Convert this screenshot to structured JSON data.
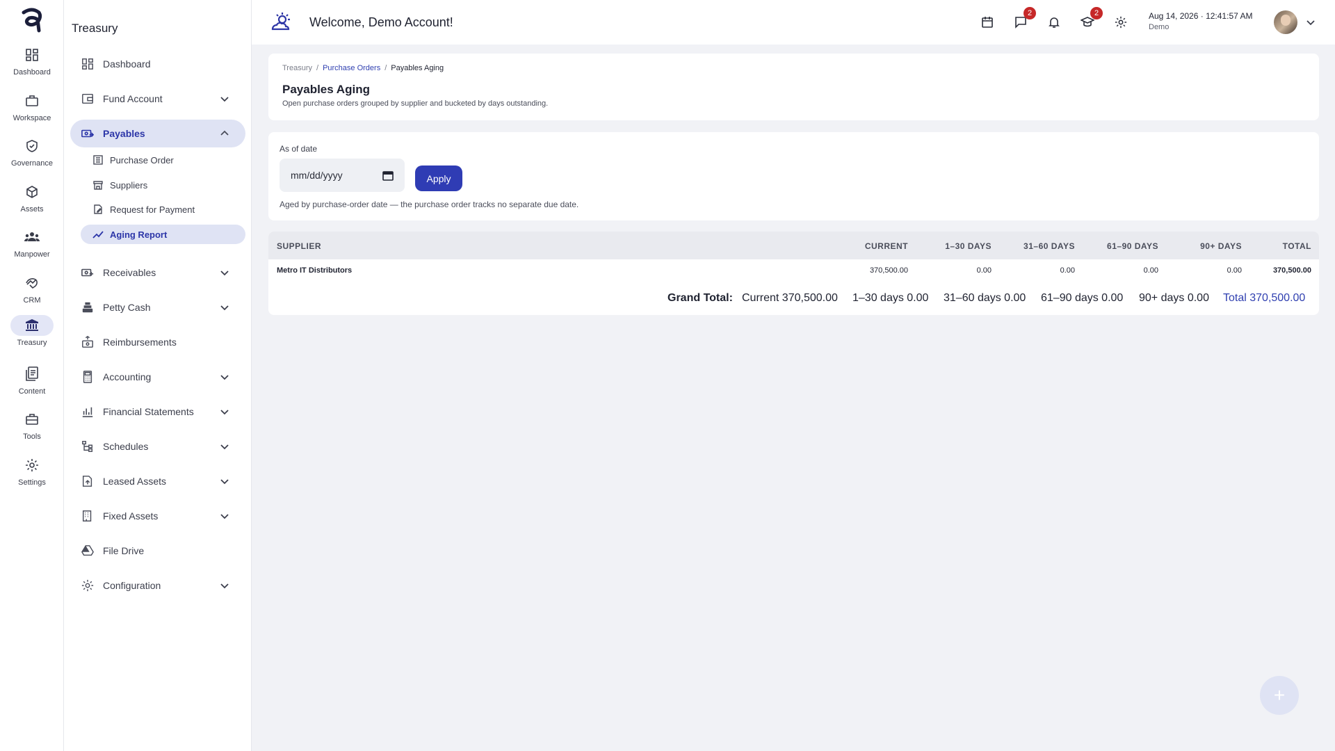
{
  "rail": {
    "items": [
      {
        "label": "Dashboard",
        "icon": "dashboard-icon"
      },
      {
        "label": "Workspace",
        "icon": "briefcase-icon"
      },
      {
        "label": "Governance",
        "icon": "shield-check-icon"
      },
      {
        "label": "Assets",
        "icon": "cube-icon"
      },
      {
        "label": "Manpower",
        "icon": "people-icon"
      },
      {
        "label": "CRM",
        "icon": "handshake-icon"
      },
      {
        "label": "Treasury",
        "icon": "bank-icon"
      },
      {
        "label": "Content",
        "icon": "documents-icon"
      },
      {
        "label": "Tools",
        "icon": "toolbox-icon"
      },
      {
        "label": "Settings",
        "icon": "gear-icon"
      }
    ]
  },
  "sidebar": {
    "title": "Treasury",
    "items": [
      {
        "label": "Dashboard",
        "icon": "dashboard-icon"
      },
      {
        "label": "Fund Account",
        "icon": "wallet-icon"
      },
      {
        "label": "Payables",
        "icon": "money-out-icon"
      },
      {
        "label": "Receivables",
        "icon": "money-in-icon"
      },
      {
        "label": "Petty Cash",
        "icon": "cash-register-icon"
      },
      {
        "label": "Reimbursements",
        "icon": "cash-hand-icon"
      },
      {
        "label": "Accounting",
        "icon": "calculator-icon"
      },
      {
        "label": "Financial Statements",
        "icon": "chart-icon"
      },
      {
        "label": "Schedules",
        "icon": "tree-icon"
      },
      {
        "label": "Leased Assets",
        "icon": "lease-icon"
      },
      {
        "label": "Fixed Assets",
        "icon": "building-icon"
      },
      {
        "label": "File Drive",
        "icon": "drive-icon"
      },
      {
        "label": "Configuration",
        "icon": "gear-icon"
      }
    ],
    "payables_sub": [
      {
        "label": "Purchase Order",
        "icon": "list-icon"
      },
      {
        "label": "Suppliers",
        "icon": "store-icon"
      },
      {
        "label": "Request for Payment",
        "icon": "doc-edit-icon"
      },
      {
        "label": "Aging Report",
        "icon": "trend-icon"
      }
    ]
  },
  "topbar": {
    "welcome": "Welcome, Demo Account!",
    "messages_badge": "2",
    "training_badge": "2",
    "date": "Aug 14, 2026 ·",
    "time": "12:41:57 AM",
    "user": "Demo"
  },
  "breadcrumb": {
    "root": "Treasury",
    "sep": "/",
    "parent": "Purchase Orders",
    "current": "Payables Aging"
  },
  "page": {
    "title": "Payables Aging",
    "subtitle": "Open purchase orders grouped by supplier and bucketed by days outstanding."
  },
  "filter": {
    "label": "As of date",
    "placeholder": "mm/dd/yyyy",
    "apply": "Apply",
    "hint": "Aged by purchase-order date — the purchase order tracks no separate due date."
  },
  "table": {
    "headers": [
      "SUPPLIER",
      "CURRENT",
      "1–30 DAYS",
      "31–60 DAYS",
      "61–90 DAYS",
      "90+ DAYS",
      "TOTAL"
    ],
    "rows": [
      {
        "supplier": "Metro IT Distributors",
        "current": "370,500.00",
        "d1_30": "0.00",
        "d31_60": "0.00",
        "d61_90": "0.00",
        "d90": "0.00",
        "total": "370,500.00"
      }
    ]
  },
  "grand_total": {
    "label": "Grand Total:",
    "current": "Current 370,500.00",
    "d1_30": "1–30 days 0.00",
    "d31_60": "31–60 days 0.00",
    "d61_90": "61–90 days 0.00",
    "d90": "90+ days 0.00",
    "total": "Total 370,500.00"
  },
  "fab": {
    "label": "+"
  }
}
